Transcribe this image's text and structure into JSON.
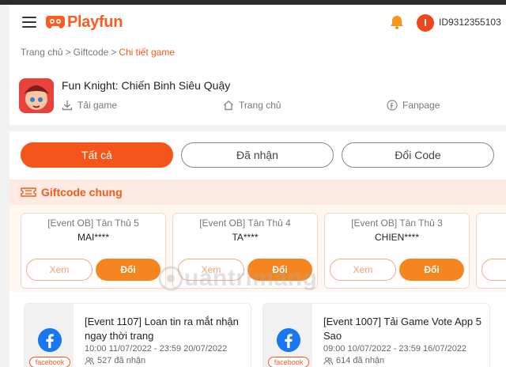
{
  "header": {
    "brand": "Playfun",
    "avatar_letter": "I",
    "user_id": "ID9312355103",
    "menu_icon": "hamburger-icon",
    "bell_icon": "bell-icon"
  },
  "breadcrumb": [
    "Trang chủ",
    "Giftcode",
    "Chi tiết game"
  ],
  "game": {
    "title": "Fun Knight: Chiến Binh Siêu Quậy",
    "links": [
      "Tải game",
      "Trang chủ",
      "Fanpage"
    ]
  },
  "tabs": [
    "Tất cả",
    "Đã nhận",
    "Đổi Code"
  ],
  "giftcode_section": {
    "title": "Giftcode chung",
    "cards": [
      {
        "name": "[Event OB] Tân Thủ 5",
        "code": "MAI****",
        "view": "Xem",
        "redeem": "Đổi"
      },
      {
        "name": "[Event OB] Tân Thủ 4",
        "code": "TA****",
        "view": "Xem",
        "redeem": "Đổi"
      },
      {
        "name": "[Event OB] Tân Thủ 3",
        "code": "CHIEN****",
        "view": "Xem",
        "redeem": "Đổi"
      },
      {
        "name": "",
        "code": "",
        "view": "Xe",
        "redeem": ""
      }
    ]
  },
  "watermark": "uantrimang",
  "events": [
    {
      "source": "facebook",
      "title": "[Event 1107] Loan tin ra mắt nhận ngay thời trang",
      "time": "10:00 11/07/2022 - 23:59 20/07/2022",
      "count": "527 đã nhận"
    },
    {
      "source": "facebook",
      "title": "[Event 1007] Tải Game Vote App 5 Sao",
      "time": "09:00 10/07/2022 - 23:59 16/07/2022",
      "count": "614 đã nhận"
    }
  ],
  "colors": {
    "accent": "#f55519",
    "redeem": "#f5861f",
    "facebook": "#1877f2"
  }
}
